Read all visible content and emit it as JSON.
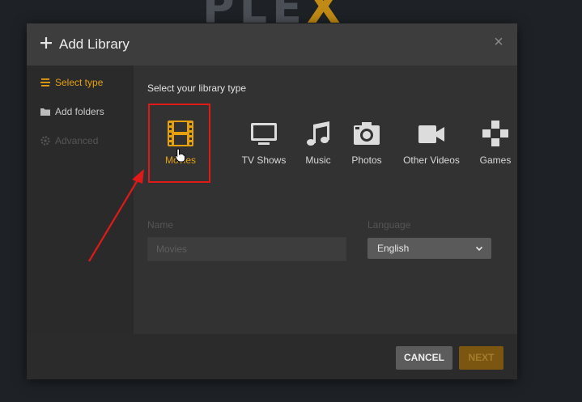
{
  "background_logo": {
    "text": "PLE",
    "accent_letter": "X"
  },
  "dialog": {
    "title": "Add Library",
    "close_symbol": "×"
  },
  "sidebar": {
    "items": [
      {
        "label": "Select type",
        "icon": "list-icon",
        "state": "active"
      },
      {
        "label": "Add folders",
        "icon": "folder-icon",
        "state": "normal"
      },
      {
        "label": "Advanced",
        "icon": "gear-icon",
        "state": "disabled"
      }
    ]
  },
  "content": {
    "section_label": "Select your library type",
    "library_types": [
      {
        "label": "Movies",
        "icon": "film-icon",
        "selected": true
      },
      {
        "label": "TV Shows",
        "icon": "monitor-icon",
        "selected": false
      },
      {
        "label": "Music",
        "icon": "music-note-icon",
        "selected": false
      },
      {
        "label": "Photos",
        "icon": "camera-icon",
        "selected": false
      },
      {
        "label": "Other Videos",
        "icon": "video-camera-icon",
        "selected": false
      },
      {
        "label": "Games",
        "icon": "gamepad-icon",
        "selected": false
      }
    ],
    "name_field": {
      "label": "Name",
      "value": "Movies"
    },
    "language_field": {
      "label": "Language",
      "value": "English"
    }
  },
  "footer": {
    "cancel_label": "CANCEL",
    "next_label": "NEXT"
  },
  "colors": {
    "accent": "#e5a00d",
    "highlight_box": "#e01919",
    "annotation_arrow": "#e01919",
    "modal_bg": "#323232"
  }
}
